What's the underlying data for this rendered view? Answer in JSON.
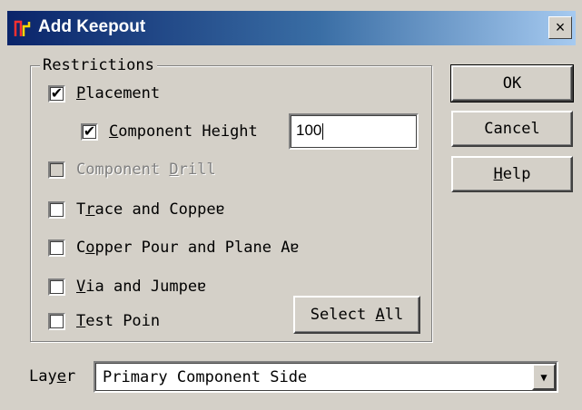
{
  "window": {
    "title": "Add Keepout",
    "close_label": "×",
    "title_icon": "keepout-icon"
  },
  "restrictions": {
    "group_label": "Restrictions",
    "items": [
      {
        "label_before": "",
        "accel": "P",
        "label_after": "lacement",
        "checked": true,
        "enabled": true
      },
      {
        "label_before": "",
        "accel": "C",
        "label_after": "omponent Height",
        "checked": true,
        "enabled": true
      },
      {
        "label_before": "Component ",
        "accel": "D",
        "label_after": "rill",
        "checked": false,
        "enabled": false
      },
      {
        "label_before": "T",
        "accel": "r",
        "label_after": "ace and Coppeɐ",
        "checked": false,
        "enabled": true
      },
      {
        "label_before": "C",
        "accel": "o",
        "label_after": "pper Pour and Plane Aɐ",
        "checked": false,
        "enabled": true
      },
      {
        "label_before": "",
        "accel": "V",
        "label_after": "ia and Jumpeɐ",
        "checked": false,
        "enabled": true
      },
      {
        "label_before": "",
        "accel": "T",
        "label_after": "est Poin",
        "checked": false,
        "enabled": true
      }
    ],
    "component_height_value": "100",
    "select_all": {
      "before": "Select ",
      "accel": "A",
      "after": "ll"
    }
  },
  "buttons": {
    "ok": "OK",
    "cancel": "Cancel",
    "help": {
      "accel": "H",
      "after": "elp"
    }
  },
  "layer": {
    "label_before": "Lay",
    "accel": "e",
    "label_after": "r",
    "selected": "Primary Component Side"
  },
  "colors": {
    "face": "#d4d0c8",
    "title_start": "#0a246a",
    "title_end": "#a6caf0",
    "disabled_text": "#808080"
  }
}
